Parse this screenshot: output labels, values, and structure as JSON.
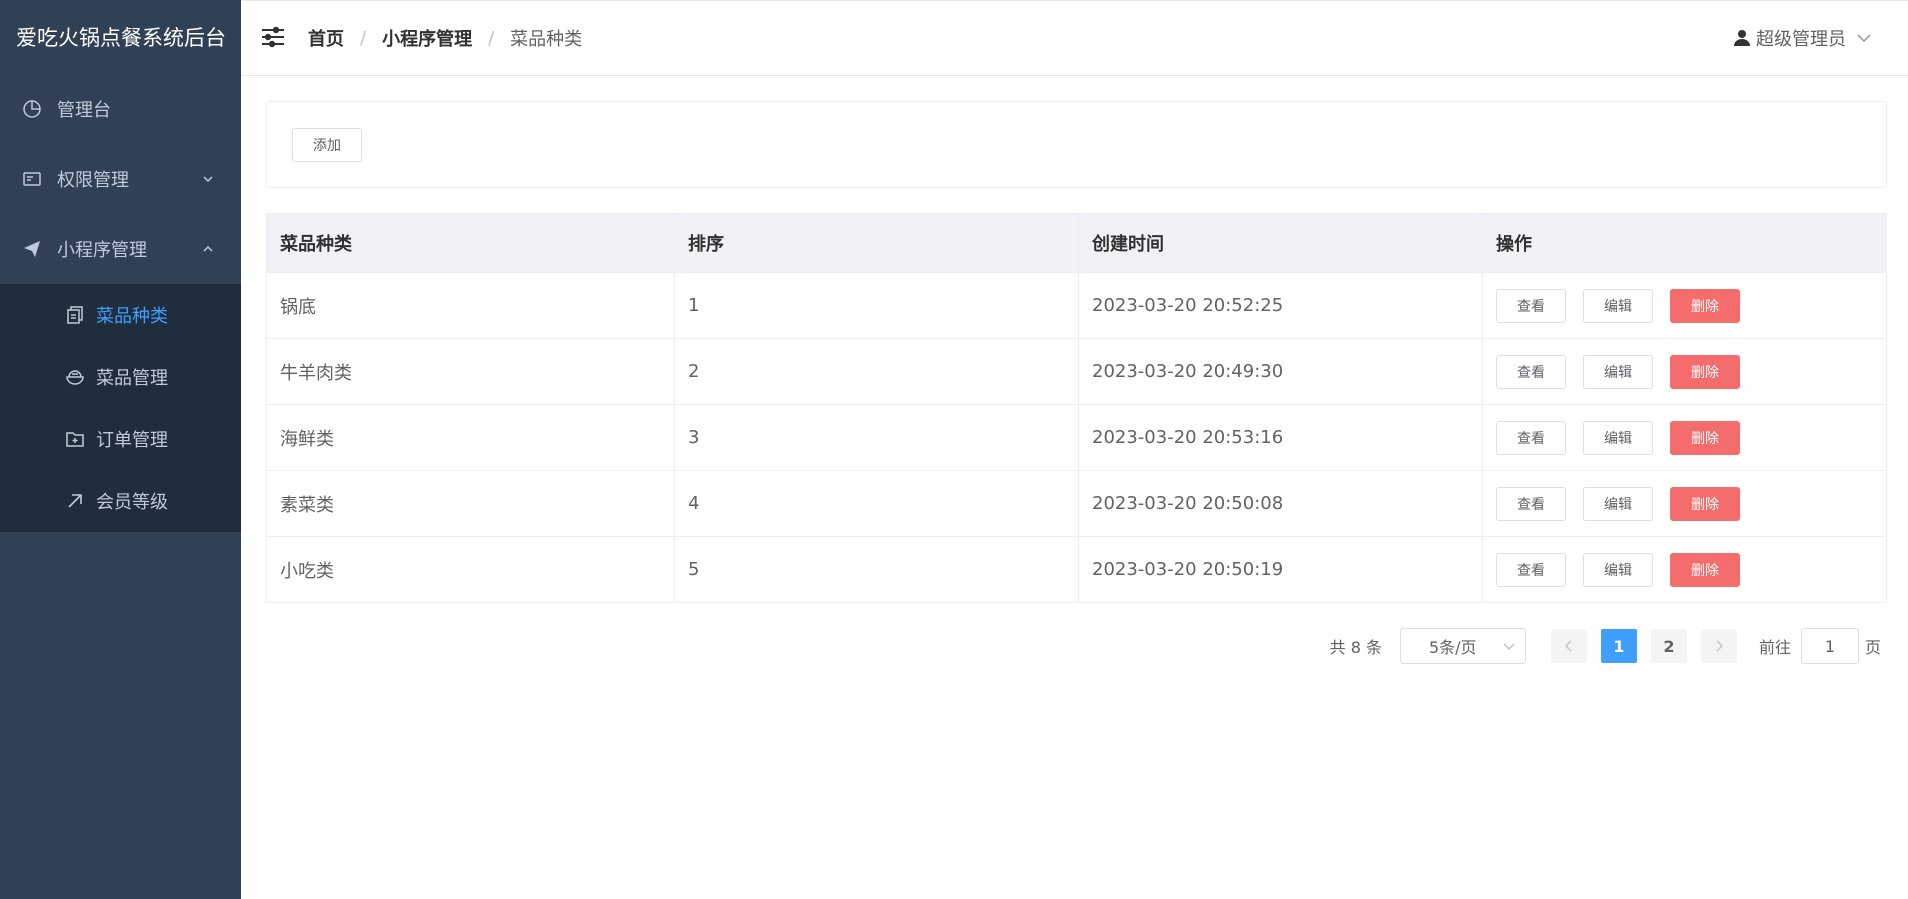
{
  "sidebar": {
    "brand": "爱吃火锅点餐系统后台",
    "items": [
      {
        "label": "管理台",
        "icon": "pie-chart-icon"
      },
      {
        "label": "权限管理",
        "icon": "id-card-icon"
      },
      {
        "label": "小程序管理",
        "icon": "paper-plane-icon"
      }
    ],
    "sub_items": [
      {
        "label": "菜品种类",
        "icon": "document-copy-icon",
        "active": true
      },
      {
        "label": "菜品管理",
        "icon": "bowl-icon"
      },
      {
        "label": "订单管理",
        "icon": "folder-add-icon"
      },
      {
        "label": "会员等级",
        "icon": "top-right-arrow-icon"
      }
    ]
  },
  "header": {
    "breadcrumb": [
      "首页",
      "小程序管理",
      "菜品种类"
    ],
    "separator": "/",
    "user": "超级管理员"
  },
  "toolbar": {
    "add_label": "添加"
  },
  "table": {
    "columns": [
      "菜品种类",
      "排序",
      "创建时间",
      "操作"
    ],
    "rows": [
      {
        "name": "锅底",
        "order": "1",
        "created": "2023-03-20 20:52:25"
      },
      {
        "name": "牛羊肉类",
        "order": "2",
        "created": "2023-03-20 20:49:30"
      },
      {
        "name": "海鲜类",
        "order": "3",
        "created": "2023-03-20 20:53:16"
      },
      {
        "name": "素菜类",
        "order": "4",
        "created": "2023-03-20 20:50:08"
      },
      {
        "name": "小吃类",
        "order": "5",
        "created": "2023-03-20 20:50:19"
      }
    ],
    "actions": {
      "view": "查看",
      "edit": "编辑",
      "delete": "删除"
    }
  },
  "pagination": {
    "total": "共 8 条",
    "page_size": "5条/页",
    "pages": [
      "1",
      "2"
    ],
    "current": "1",
    "goto_prefix": "前往",
    "goto_value": "1",
    "goto_suffix": "页"
  },
  "colors": {
    "sidebar_bg": "#304156",
    "submenu_bg": "#1f2d3d",
    "accent": "#409eff",
    "danger": "#f56c6c"
  }
}
